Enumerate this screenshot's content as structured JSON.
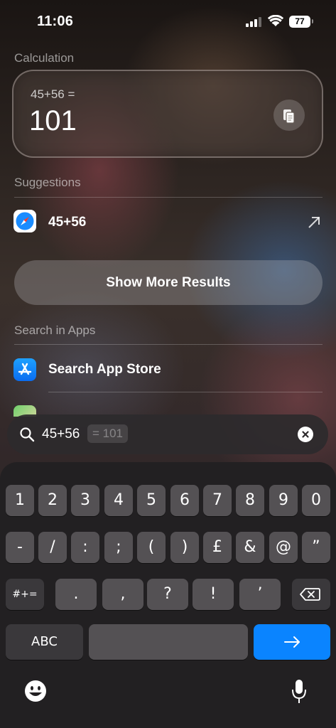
{
  "status_bar": {
    "time": "11:06",
    "battery": "77"
  },
  "calculation": {
    "section_label": "Calculation",
    "expression": "45+56 =",
    "result": "101"
  },
  "suggestions": {
    "section_label": "Suggestions",
    "items": [
      {
        "label": "45+56",
        "icon": "safari-icon"
      }
    ]
  },
  "show_more_label": "Show More Results",
  "search_in_apps": {
    "section_label": "Search in Apps",
    "items": [
      {
        "label": "Search App Store",
        "icon": "app-store-icon"
      }
    ]
  },
  "search": {
    "query": "45+56",
    "inline_hint": "= 101"
  },
  "keyboard": {
    "row1": [
      "1",
      "2",
      "3",
      "4",
      "5",
      "6",
      "7",
      "8",
      "9",
      "0"
    ],
    "row2": [
      "-",
      "/",
      ":",
      ";",
      "(",
      ")",
      "£",
      "&",
      "@",
      "”"
    ],
    "row3": [
      ".",
      ",",
      "?",
      "!",
      "’"
    ],
    "symbols_toggle": "#+=",
    "abc_label": "ABC",
    "go_icon": "arrow-right-icon",
    "delete_icon": "delete-icon"
  },
  "colors": {
    "accent": "#0a84ff",
    "key": "#545154",
    "keyboard_bg": "#222022"
  }
}
